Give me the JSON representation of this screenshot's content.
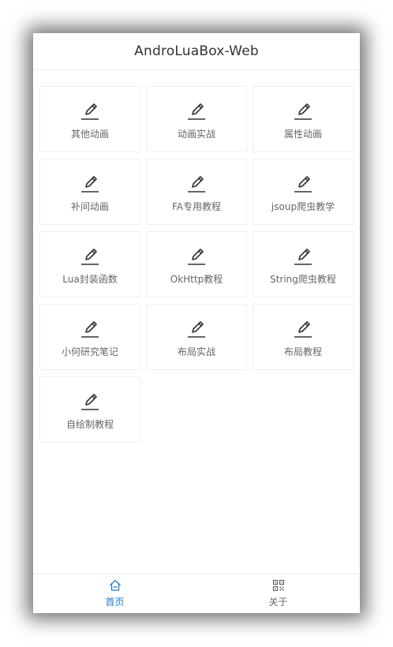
{
  "app": {
    "title": "AndroLuaBox-Web"
  },
  "grid": {
    "icon": "pencil-icon",
    "items": [
      {
        "label": "其他动画"
      },
      {
        "label": "动画实战"
      },
      {
        "label": "属性动画"
      },
      {
        "label": "补间动画"
      },
      {
        "label": "FA专用教程"
      },
      {
        "label": "jsoup爬虫教学"
      },
      {
        "label": "Lua封装函数"
      },
      {
        "label": "OkHttp教程"
      },
      {
        "label": "String爬虫教程"
      },
      {
        "label": "小何研究笔记"
      },
      {
        "label": "布局实战"
      },
      {
        "label": "布局教程"
      },
      {
        "label": "自绘制教程"
      }
    ]
  },
  "tabbar": {
    "tabs": [
      {
        "label": "首页",
        "icon": "home-icon",
        "active": true
      },
      {
        "label": "关于",
        "icon": "qr-grid-icon",
        "active": false
      }
    ],
    "active_color": "#1e7ad1",
    "inactive_color": "#666666"
  }
}
